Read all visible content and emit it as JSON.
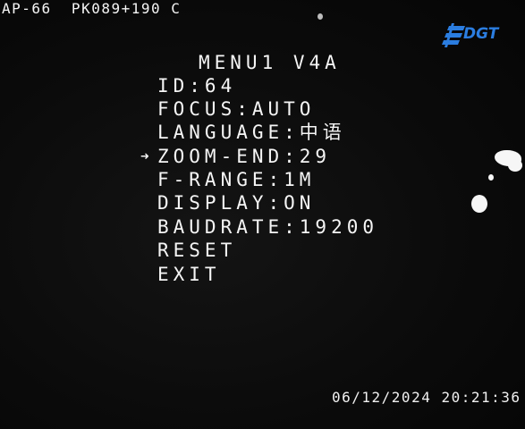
{
  "camera": {
    "label": "AP-66  PK089+190 C"
  },
  "logo": {
    "text": "DGT",
    "color": "#2b7de0",
    "icon": "dgt-logo-icon"
  },
  "menu": {
    "title": "MENU1 V4A",
    "cursor_symbol": "➜",
    "selected_index": 3,
    "items": [
      {
        "label": "ID:64"
      },
      {
        "label": "FOCUS:AUTO"
      },
      {
        "label": "LANGUAGE:中语"
      },
      {
        "label": "ZOOM-END:29"
      },
      {
        "label": "F-RANGE:1M"
      },
      {
        "label": "DISPLAY:ON"
      },
      {
        "label": "BAUDRATE:19200"
      },
      {
        "label": "RESET"
      },
      {
        "label": "EXIT"
      }
    ]
  },
  "timestamp": {
    "date": "06/12/2024",
    "time": "20:21:36"
  }
}
